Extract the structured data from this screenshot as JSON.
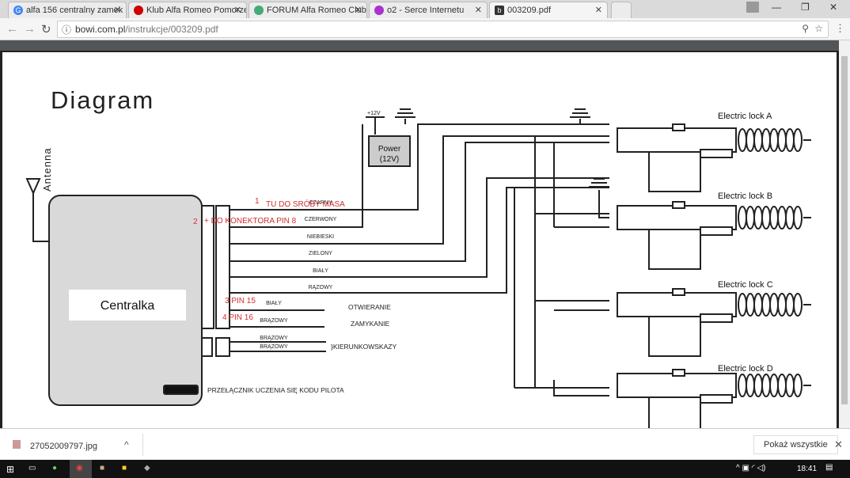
{
  "tabs": [
    {
      "title": "alfa 156 centralny zamek",
      "icon": "google-icon",
      "color": "#4285f4"
    },
    {
      "title": "Klub Alfa Romeo Pomorze",
      "icon": "alfa-romeo-icon",
      "color": "#c00"
    },
    {
      "title": "FORUM Alfa Romeo Club",
      "icon": "forum-icon",
      "color": "#4a7"
    },
    {
      "title": "o2 - Serce Internetu",
      "icon": "o2-icon",
      "color": "#a3c"
    },
    {
      "title": "003209.pdf",
      "icon": "pdf-icon",
      "color": "#333"
    }
  ],
  "url": {
    "host": "bowi.com.pl",
    "path": "/instrukcje/003209.pdf"
  },
  "diagram": {
    "title": "Diagram",
    "antenna": "Antenna",
    "unit": "Centralka",
    "power": "Power",
    "power_v": "(12V)",
    "plus12": "+12V",
    "wires": [
      "CZARNY",
      "CZERWONY",
      "NIEBIESKI",
      "ZIELONY",
      "BIAŁY",
      "RĄZOWY",
      "BIAŁY",
      "BRĄZOWY",
      "BRĄZOWY",
      "BRĄZOWY"
    ],
    "functions": [
      "OTWIERANIE",
      "ZAMYKANIE",
      "}KIERUNKOWSKAZY"
    ],
    "switch": "PRZEŁĄCZNIK UCZENIA SIĘ KODU PILOTA",
    "locks": [
      "Electric lock A",
      "Electric lock B",
      "Electric lock C",
      "Electric lock D"
    ],
    "annotations": [
      "1",
      "TU DO SRÓBY MASA",
      "2",
      "+ DO KONEKTORA PIN 8",
      "3 PIN 15",
      "4 PIN 16"
    ],
    "annotation_color": "#d0302f"
  },
  "downloads": {
    "file": "27052009797.jpg",
    "show_all": "Pokaż wszystkie"
  },
  "taskbar": {
    "time": "18:41"
  }
}
